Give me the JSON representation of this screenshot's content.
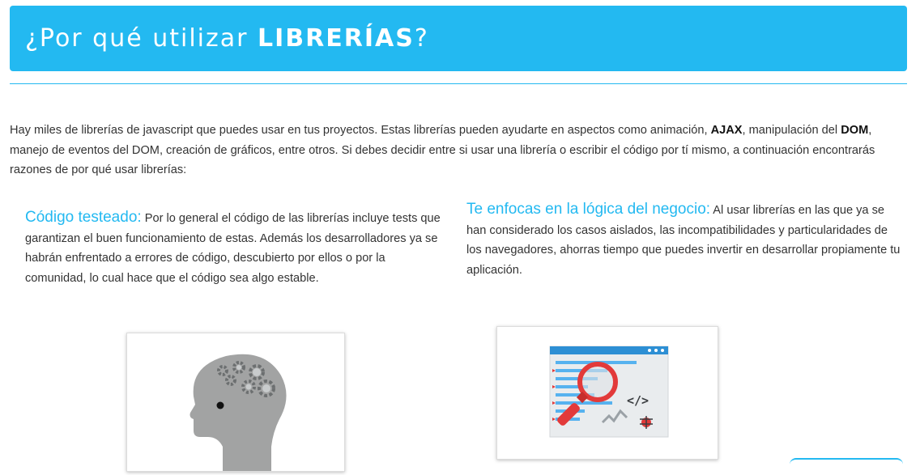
{
  "header": {
    "title_prefix": "¿Por qué utilizar ",
    "title_bold": "LIBRERÍAS",
    "title_suffix": "?"
  },
  "intro": {
    "part1": "Hay miles de librerías de javascript que puedes usar en tus proyectos. Estas librerías pueden ayudarte en aspectos como animación, ",
    "ajax": "AJAX",
    "part2": ", manipulación del ",
    "dom": "DOM",
    "part3": ", manejo de eventos del DOM, creación de gráficos, entre otros. Si debes decidir entre si usar una librería o escribir el código por tí mismo, a continuación encontrarás razones de por qué usar librerías:"
  },
  "reasons": [
    {
      "title": "Código testeado:",
      "text": " Por lo general el código de las librerías incluye tests que garantizan el buen funcionamiento de estas. Además los desarrolladores ya se habrán enfrentado a errores de código, descubierto por ellos o por la comunidad, lo cual hace que el código sea algo estable."
    },
    {
      "title": "Te enfocas en la lógica del negocio:",
      "text": " Al usar librerías en las que ya se han considerado los casos aislados, las incompatibilidades y particularidades de los navegadores, ahorras tiempo que puedes invertir en desarrollar propiamente tu aplicación."
    }
  ],
  "illustrations": [
    {
      "icon": "head-gears-icon"
    },
    {
      "icon": "code-magnifier-icon",
      "code_label": "</>"
    }
  ],
  "colors": {
    "accent": "#23b9f1",
    "head_gray": "#a2a3a3",
    "magnifier_red": "#e23a3a"
  }
}
